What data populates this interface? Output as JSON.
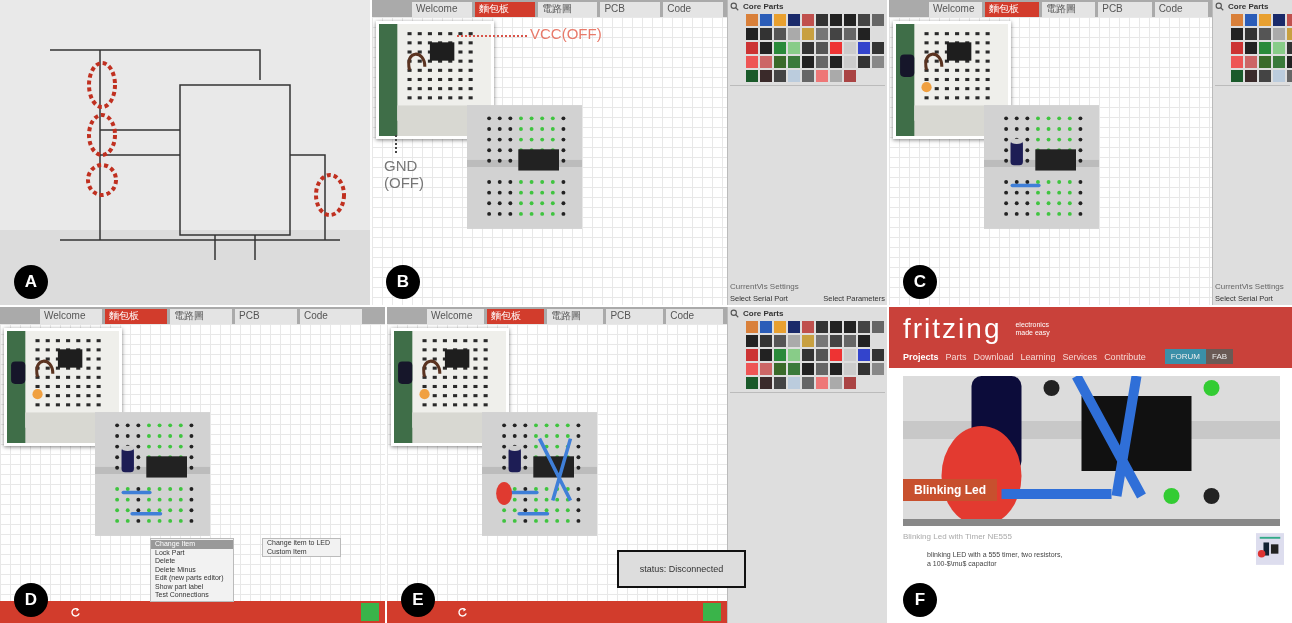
{
  "panels": [
    {
      "label": "A"
    },
    {
      "label": "B",
      "kind": "fritzing",
      "tabs": [
        {
          "label": "Welcome",
          "selected": false
        },
        {
          "label": "麵包板",
          "selected": true
        },
        {
          "label": "電路圖",
          "selected": false
        },
        {
          "label": "PCB",
          "selected": false
        },
        {
          "label": "Code",
          "selected": false
        }
      ],
      "annotations": [
        "VCC(OFF)",
        "GND (OFF)"
      ],
      "sidebar": {
        "title": "Core Parts",
        "settings": "CurrentVis Settings",
        "fields": [
          "Select Serial Port",
          "Select Parameters"
        ]
      }
    },
    {
      "label": "C",
      "kind": "fritzing",
      "tabs": [
        {
          "label": "Welcome",
          "selected": false
        },
        {
          "label": "麵包板",
          "selected": true
        },
        {
          "label": "電路圖",
          "selected": false
        },
        {
          "label": "PCB",
          "selected": false
        },
        {
          "label": "Code",
          "selected": false
        }
      ],
      "sidebar": {
        "title": "Core Parts",
        "settings": "CurrentVis Settings",
        "fields": [
          "Select Serial Port"
        ]
      }
    },
    {
      "label": "D",
      "kind": "fritzing",
      "tabs": [
        {
          "label": "Welcome",
          "selected": false
        },
        {
          "label": "麵包板",
          "selected": true
        },
        {
          "label": "電路圖",
          "selected": false
        },
        {
          "label": "PCB",
          "selected": false
        },
        {
          "label": "Code",
          "selected": false
        }
      ],
      "menu": {
        "items": [
          {
            "label": "Change Item",
            "selected": true
          },
          {
            "label": "Lock Part",
            "selected": false
          },
          {
            "label": "Delete",
            "selected": false
          },
          {
            "label": "Delete Minus",
            "selected": false
          },
          {
            "label": "Edit (new parts editor)",
            "selected": false
          },
          {
            "label": "Show part label",
            "selected": false
          },
          {
            "label": "Test Connections",
            "selected": false
          }
        ],
        "submenu": [
          "Change item to LED",
          "Custom Item"
        ]
      },
      "toolbar": true
    },
    {
      "label": "E",
      "kind": "fritzing",
      "tabs": [
        {
          "label": "Welcome",
          "selected": false
        },
        {
          "label": "麵包板",
          "selected": true
        },
        {
          "label": "電路圖",
          "selected": false
        },
        {
          "label": "PCB",
          "selected": false
        },
        {
          "label": "Code",
          "selected": false
        }
      ],
      "sidebar": {
        "title": "Core Parts"
      },
      "callout": "status: Disconnected",
      "toolbar": true
    },
    {
      "label": "F",
      "kind": "website",
      "logo": "fritzing",
      "tagline": "electronics made easy",
      "nav": [
        {
          "label": "Projects",
          "selected": true
        },
        {
          "label": "Parts",
          "selected": false
        },
        {
          "label": "Download",
          "selected": false
        },
        {
          "label": "Learning",
          "selected": false
        },
        {
          "label": "Services",
          "selected": false
        },
        {
          "label": "Contribute",
          "selected": false
        }
      ],
      "buttons": [
        "FORUM",
        "FAB"
      ],
      "banner": "Blinking Led",
      "project_title": "Blinking Led with Timer NE555",
      "description": [
        "blinking LED with a 555 timer, two resistors,",
        "a 100-$\\mu$ capacitor"
      ]
    }
  ]
}
